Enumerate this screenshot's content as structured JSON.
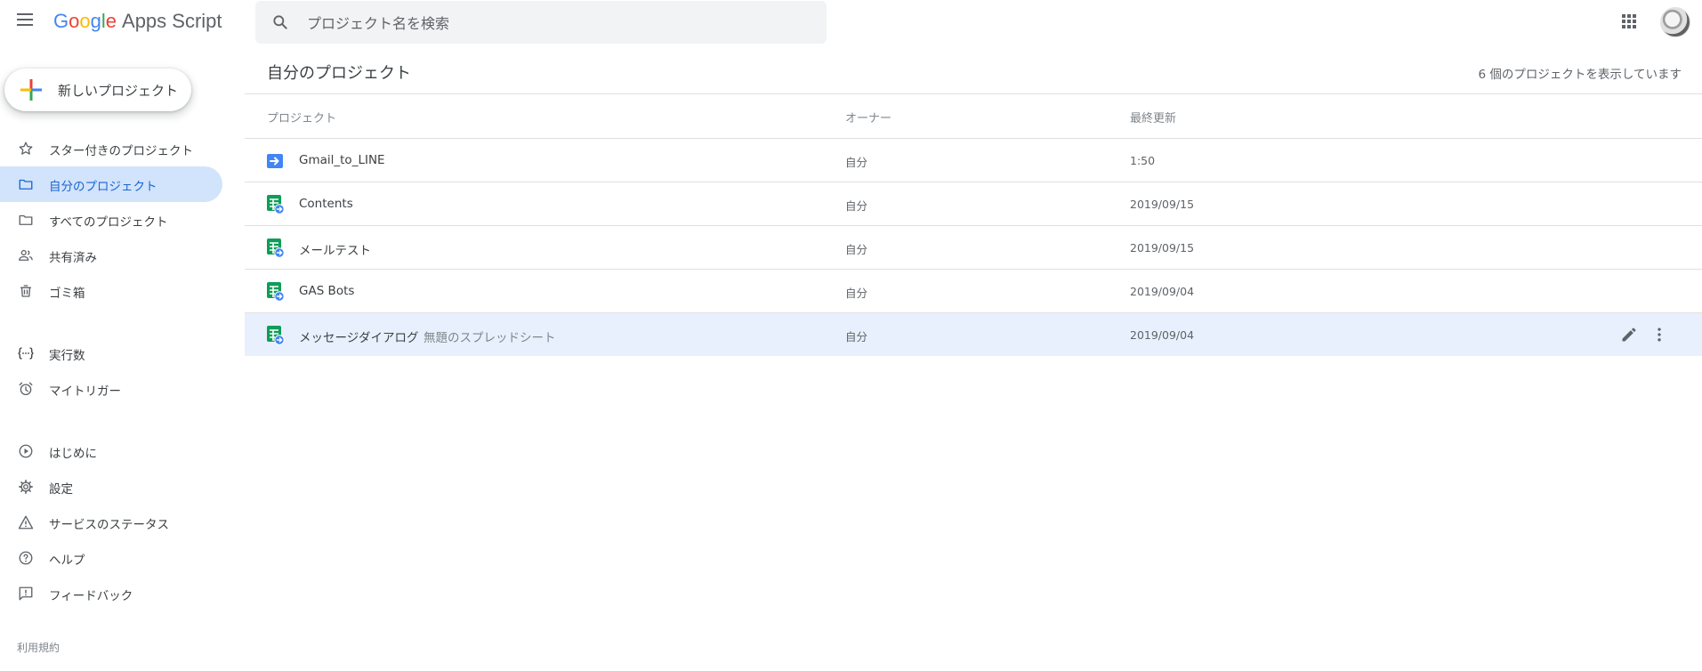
{
  "header": {
    "logo": {
      "g1": "G",
      "o1": "o",
      "o2": "o",
      "g2": "g",
      "l": "l",
      "e": "e",
      "product": "Apps Script"
    },
    "search": {
      "placeholder": "プロジェクト名を検索"
    }
  },
  "sidebar": {
    "new_project_label": "新しいプロジェクト",
    "items": [
      {
        "label": "スター付きのプロジェクト",
        "icon": "star-icon"
      },
      {
        "label": "自分のプロジェクト",
        "icon": "folder-icon",
        "active": true
      },
      {
        "label": "すべてのプロジェクト",
        "icon": "folder-icon"
      },
      {
        "label": "共有済み",
        "icon": "people-icon"
      },
      {
        "label": "ゴミ箱",
        "icon": "trash-icon"
      },
      {
        "label": "実行数",
        "icon": "executions-icon"
      },
      {
        "label": "マイトリガー",
        "icon": "alarm-icon"
      },
      {
        "label": "はじめに",
        "icon": "play-circle-icon"
      },
      {
        "label": "設定",
        "icon": "gear-icon"
      },
      {
        "label": "サービスのステータス",
        "icon": "warning-icon"
      },
      {
        "label": "ヘルプ",
        "icon": "help-icon"
      },
      {
        "label": "フィードバック",
        "icon": "feedback-icon"
      }
    ],
    "terms": "利用規約"
  },
  "main": {
    "title": "自分のプロジェクト",
    "count_text": "6 個のプロジェクトを表示しています",
    "columns": {
      "project": "プロジェクト",
      "owner": "オーナー",
      "updated": "最終更新"
    },
    "rows": [
      {
        "name": "Gmail_to_LINE",
        "desc": "",
        "owner": "自分",
        "updated": "1:50",
        "type": "standalone"
      },
      {
        "name": "Contents",
        "desc": "",
        "owner": "自分",
        "updated": "2019/09/15",
        "type": "sheets"
      },
      {
        "name": "メールテスト",
        "desc": "",
        "owner": "自分",
        "updated": "2019/09/15",
        "type": "sheets"
      },
      {
        "name": "GAS Bots",
        "desc": "",
        "owner": "自分",
        "updated": "2019/09/04",
        "type": "sheets"
      },
      {
        "name": "メッセージダイアログ",
        "desc": "無題のスプレッドシート",
        "owner": "自分",
        "updated": "2019/09/04",
        "type": "sheets",
        "selected": true
      }
    ]
  },
  "colors": {
    "accent": "#1967d2",
    "active_bg": "#d2e3fc",
    "selected_row_bg": "#e8f0fe",
    "sheets_green": "#0f9d58",
    "script_blue": "#4285f4"
  }
}
